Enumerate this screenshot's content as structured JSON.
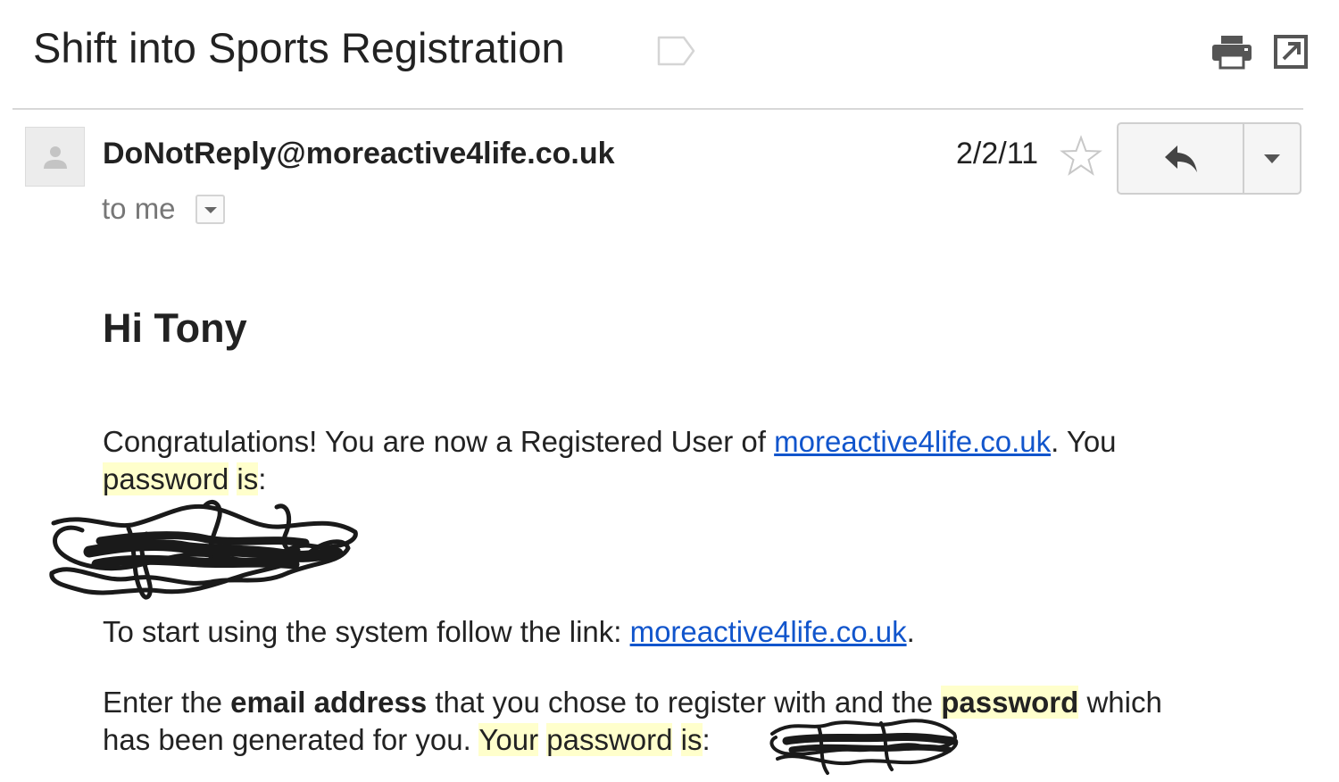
{
  "email": {
    "subject": "Shift into Sports Registration",
    "sender": "DoNotReply@moreactive4life.co.uk",
    "date": "2/2/11",
    "recipient_line": "to me"
  },
  "toolbar": {
    "print_icon": "print-icon",
    "popout_icon": "open-in-new-window-icon",
    "label_icon": "label-tag-icon"
  },
  "actions": {
    "reply_icon": "reply-icon",
    "more_icon": "dropdown-arrow-icon",
    "star_icon": "star-outline-icon"
  },
  "body": {
    "greeting": "Hi Tony",
    "p1_text1": "Congratulations! You are now a Registered User of ",
    "p1_link": "moreactive4life.co.uk",
    "p1_text2": ". You",
    "p1_word_password": "password",
    "p1_word_is": "is",
    "p1_colon": ":",
    "p2_text1": "To start using the system follow the link: ",
    "p2_link": "moreactive4life.co.uk",
    "p2_text2": ".",
    "p3_text1": "Enter the ",
    "p3_bold1": "email address",
    "p3_text2": " that you chose to register with and the ",
    "p3_bold2": "password",
    "p3_text3": " which",
    "p3_text4": "has been generated for you. ",
    "p3_word_your": "Your",
    "p3_word_password": "password",
    "p3_word_is": "is",
    "p3_colon": ":"
  },
  "colors": {
    "link": "#1155cc",
    "highlight": "#ffffcc",
    "text": "#222222",
    "muted": "#777777"
  }
}
